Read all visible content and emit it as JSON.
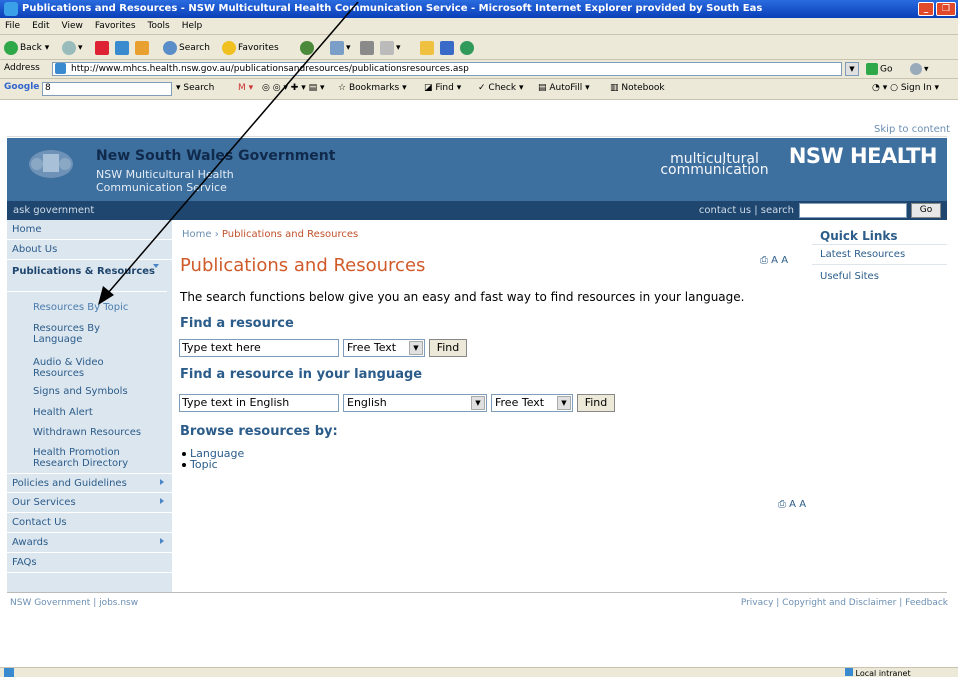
{
  "window": {
    "title": "Publications and Resources - NSW Multicultural Health Communication Service - Microsoft Internet Explorer provided by South Eas"
  },
  "menu": [
    "File",
    "Edit",
    "View",
    "Favorites",
    "Tools",
    "Help"
  ],
  "toolbar": {
    "back": "Back",
    "search": "Search",
    "favorites": "Favorites"
  },
  "address": {
    "label": "Address",
    "url": "http://www.mhcs.health.nsw.gov.au/publicationsandresources/publicationsresources.asp",
    "go": "Go"
  },
  "google_bar": {
    "logo": "Google",
    "field": "8",
    "search": "Search",
    "bookmarks": "Bookmarks",
    "find": "Find",
    "check": "Check",
    "autofill": "AutoFill",
    "notebook": "Notebook",
    "signin": "Sign In"
  },
  "page": {
    "skip": "Skip to content",
    "gov_name": "New South Wales Government",
    "service_name": "NSW Multicultural Health Communication Service",
    "mc_logo": "multicultural communication",
    "nsw_health": "NSW HEALTH",
    "nav_left": "ask government",
    "nav_right": "contact us | search",
    "go": "Go"
  },
  "left_nav": {
    "home": "Home",
    "about": "About Us",
    "pubs": "Publications & Resources",
    "subs": [
      "Resources By Topic",
      "Resources By Language",
      "Audio & Video Resources",
      "Signs and Symbols",
      "Health Alert",
      "Withdrawn Resources",
      "Health Promotion Research Directory"
    ],
    "policies": "Policies and Guidelines",
    "services": "Our Services",
    "contact": "Contact Us",
    "awards": "Awards",
    "faqs": "FAQs"
  },
  "main": {
    "breadcrumb_home": "Home",
    "breadcrumb_sep": "›",
    "breadcrumb_current": "Publications and Resources",
    "title": "Publications and Resources",
    "print_icons": "⎙ A A",
    "intro": "The search functions below give you an easy and fast way to find resources in your language.",
    "find_resource": "Find a resource",
    "text_placeholder": "Type text here",
    "free_text": "Free Text",
    "find": "Find",
    "find_in_language": "Find a resource in your language",
    "text_english": "Type text in English",
    "language": "English",
    "browse": "Browse resources by:",
    "browse_items": [
      "Language",
      "Topic"
    ]
  },
  "quick_links": {
    "title": "Quick Links",
    "items": [
      "Latest Resources",
      "Useful Sites"
    ]
  },
  "footer": {
    "left": "NSW Government | jobs.nsw",
    "right": "Privacy | Copyright and Disclaimer | Feedback"
  },
  "status": {
    "zone": "Local intranet"
  }
}
